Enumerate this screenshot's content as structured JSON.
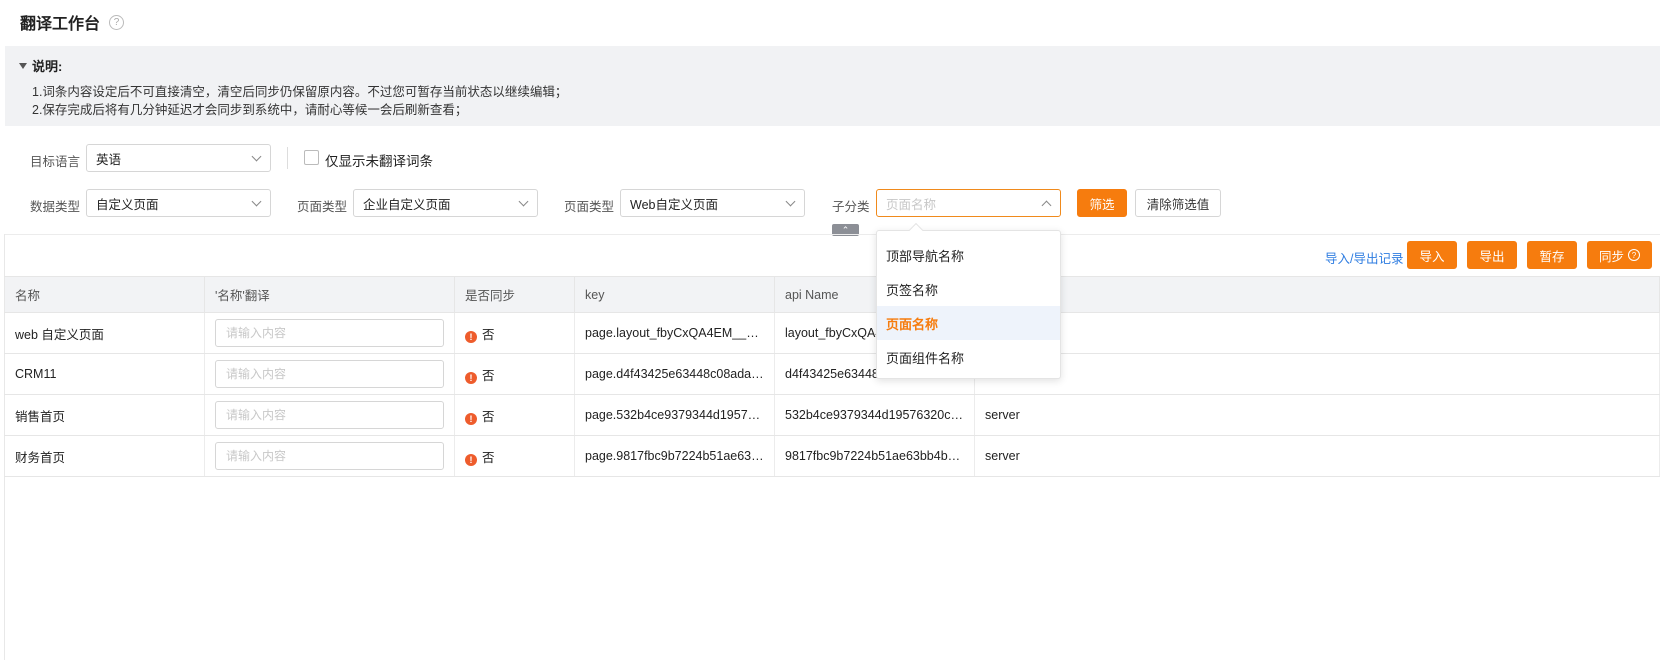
{
  "header": {
    "title": "翻译工作台",
    "help_icon": "question-icon"
  },
  "notice": {
    "title": "说明:",
    "lines": [
      "1.词条内容设定后不可直接清空，清空后同步仍保留原内容。不过您可暂存当前状态以继续编辑；",
      "2.保存完成后将有几分钟延迟才会同步到系统中，请耐心等候一会后刷新查看；"
    ]
  },
  "filters": {
    "target_lang_label": "目标语言",
    "target_lang_value": "英语",
    "only_untranslated_label": "仅显示未翻译词条",
    "data_type_label": "数据类型",
    "data_type_value": "自定义页面",
    "page_type_label": "页面类型",
    "page_type_value": "企业自定义页面",
    "page_type2_label": "页面类型",
    "page_type2_value": "Web自定义页面",
    "subcategory_label": "子分类",
    "subcategory_placeholder": "页面名称",
    "filter_button": "筛选",
    "clear_button": "清除筛选值"
  },
  "subcategory_dropdown": {
    "options": [
      "顶部导航名称",
      "页签名称",
      "页面名称",
      "页面组件名称"
    ],
    "selected": "页面名称"
  },
  "toolbar": {
    "records_link": "导入/导出记录",
    "import": "导入",
    "export": "导出",
    "save_draft": "暂存",
    "sync": "同步"
  },
  "table": {
    "columns": [
      "名称",
      "'名称'翻译",
      "是否同步",
      "key",
      "api Name",
      ""
    ],
    "input_placeholder": "请输入内容",
    "rows": [
      {
        "name": "web 自定义页面",
        "synced": "否",
        "key": "page.layout_fbyCxQA4EM__c....",
        "api_name": "layout_fbyCxQA4",
        "source": ""
      },
      {
        "name": "CRM11",
        "synced": "否",
        "key": "page.d4f43425e63448c08adab...",
        "api_name": "d4f43425e63448",
        "source": ""
      },
      {
        "name": "销售首页",
        "synced": "否",
        "key": "page.532b4ce9379344d19576...",
        "api_name": "532b4ce9379344d19576320c4...",
        "source": "server"
      },
      {
        "name": "财务首页",
        "synced": "否",
        "key": "page.9817fbc9b7224b51ae63b...",
        "api_name": "9817fbc9b7224b51ae63bb4b7...",
        "source": "server"
      }
    ]
  },
  "colors": {
    "accent": "#f67c0e",
    "link": "#2f7de1",
    "warning": "#ee5c2c"
  }
}
